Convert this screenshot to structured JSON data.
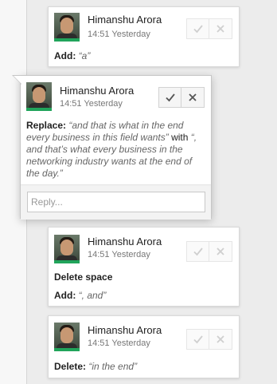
{
  "comments": [
    {
      "author": "Himanshu Arora",
      "time": "14:51 Yesterday",
      "lines": [
        {
          "label": "Add:",
          "quote": "“a”"
        }
      ]
    },
    {
      "author": "Himanshu Arora",
      "time": "14:51 Yesterday",
      "replace": {
        "label": "Replace:",
        "from": "“and that is what in the end every business in this field wants”",
        "with_word": " with ",
        "to": "“, and that’s what every business in the networking industry wants at the end of the day.”"
      },
      "reply_placeholder": "Reply..."
    },
    {
      "author": "Himanshu Arora",
      "time": "14:51 Yesterday",
      "plain": "Delete space",
      "lines": [
        {
          "label": "Add:",
          "quote": "“, and”"
        }
      ]
    },
    {
      "author": "Himanshu Arora",
      "time": "14:51 Yesterday",
      "lines": [
        {
          "label": "Delete:",
          "quote": "“in the end”"
        }
      ]
    }
  ],
  "colors": {
    "avatar_bar": "#21a45b",
    "background": "#ececec"
  },
  "icons": {
    "accept": "check-icon",
    "reject": "close-icon"
  }
}
